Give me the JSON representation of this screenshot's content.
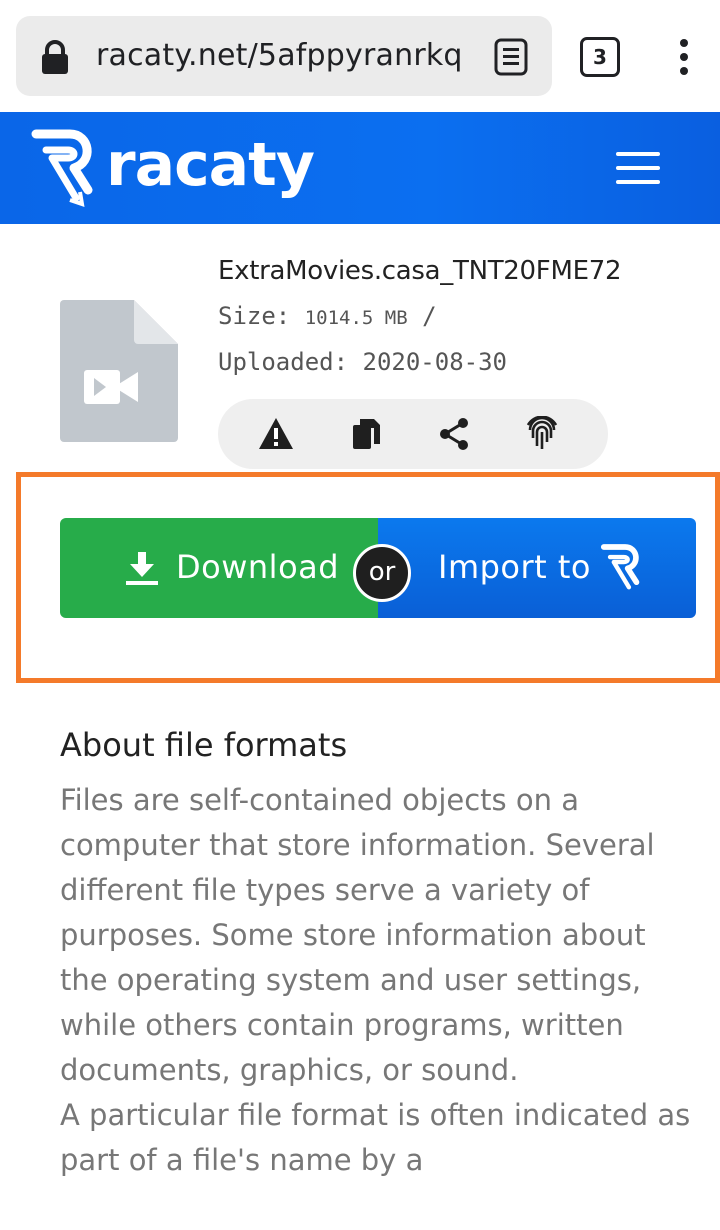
{
  "browser": {
    "url": "racaty.net/5afppyranrkq",
    "tab_count": "3"
  },
  "header": {
    "logo_text": "racaty"
  },
  "file": {
    "name": "ExtraMovies.casa_TNT20FME72",
    "size_label": "Size:",
    "size_value": "1014.5 MB",
    "size_sep": "/",
    "uploaded_label": "Uploaded:",
    "uploaded_value": "2020-08-30"
  },
  "buttons": {
    "download": "Download",
    "or": "or",
    "import": "Import to"
  },
  "about": {
    "title": "About file formats",
    "paragraphs": [
      "Files are self-contained objects on a computer that store information. Several different file types serve a variety of purposes. Some store information about the operating system and user settings, while others contain programs, written documents, graphics, or sound.",
      "A particular file format is often indicated as part of a file's name by a"
    ]
  },
  "colors": {
    "brand_blue": "#0a66e8",
    "download_green": "#27ac4a",
    "highlight_orange": "#f47a2a"
  },
  "icons": [
    "lock-icon",
    "reader-mode-icon",
    "tabs-counter",
    "overflow-menu-icon",
    "hamburger-menu-icon",
    "video-file-icon",
    "report-icon",
    "copy-icon",
    "share-icon",
    "fingerprint-icon",
    "download-icon"
  ]
}
